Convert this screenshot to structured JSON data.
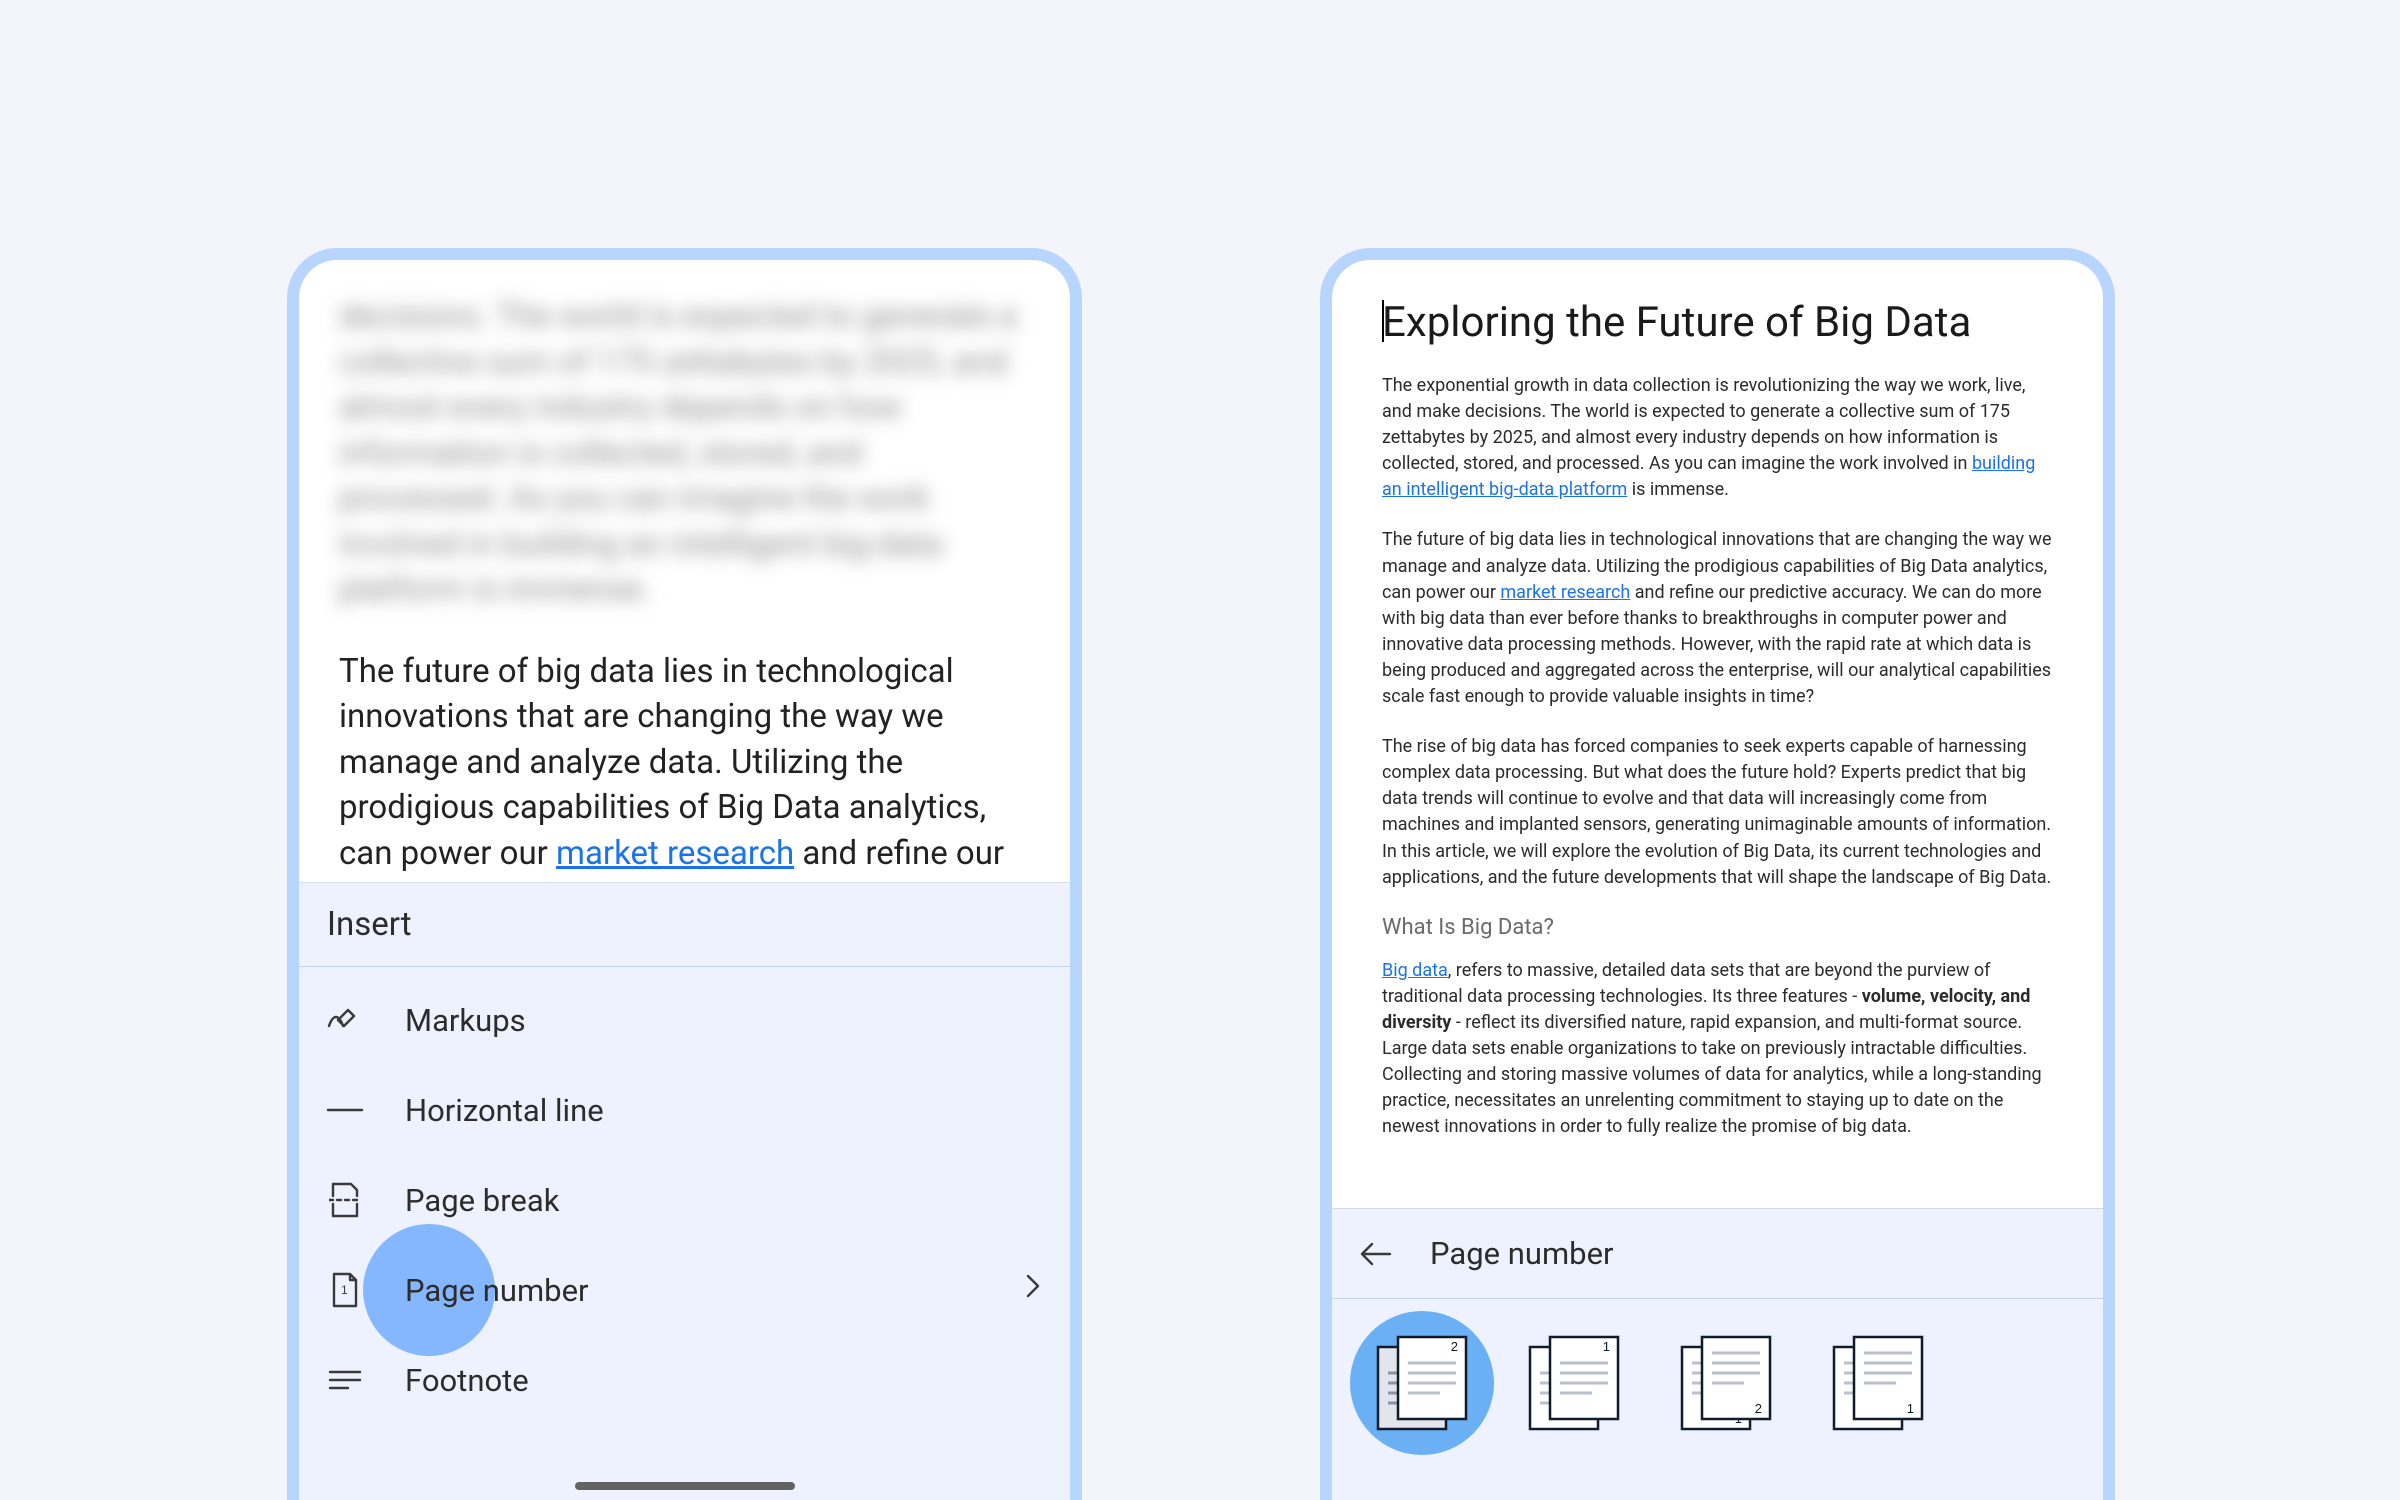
{
  "left": {
    "blurred_text": "decisions. The world is expected to generate a collective sum of 175 zettabytes by 2025, and almost every industry depends on how information is collected, stored, and processed. As you can imagine the work involved in building an intelligent big-data platform is immense.",
    "clear_para_pre": "The future of big data lies in technological innovations that are changing the way we manage and analyze data. Utilizing the prodigious capabilities of Big Data analytics, can power our ",
    "clear_para_link": "market research",
    "clear_para_post": " and refine our predictive accuracy. We can do more with big data than ever before thanks to breakthroughs in",
    "insert_header": "Insert",
    "menu": {
      "markups": "Markups",
      "hr": "Horizontal line",
      "pagebreak": "Page break",
      "pagenumber": "Page number",
      "footnote": "Footnote"
    }
  },
  "right": {
    "title": "Exploring the Future of Big Data",
    "p1_pre": "The exponential growth in data collection is revolutionizing the way we work, live, and make decisions. The world is expected to generate a collective sum of 175 zettabytes by 2025, and almost every industry depends on how information is collected, stored, and processed. As you can imagine the work involved in ",
    "p1_link": "building an intelligent big-data platform",
    "p1_post": " is immense.",
    "p2_pre": "The future of big data lies in technological innovations that are changing the way we manage and analyze data. Utilizing the prodigious capabilities of Big Data analytics, can power our ",
    "p2_link": "market research",
    "p2_post": " and refine our predictive accuracy. We can do more with big data than ever before thanks to breakthroughs in computer power and innovative data processing methods. However, with the rapid rate at which data is being produced and aggregated across the enterprise, will our analytical capabilities scale fast enough to provide valuable insights in time?",
    "p3": "The rise of big data has forced companies to seek experts capable of harnessing complex data processing. But what does the future hold? Experts predict that big data trends will continue to evolve and that data will increasingly come from machines and implanted sensors, generating unimaginable amounts of information. In this article, we will explore the evolution of Big Data, its current technologies and applications, and the future developments that will shape the landscape of Big Data.",
    "subhead": "What Is Big Data?",
    "p4_link": "Big data",
    "p4_pre": ", refers to massive, detailed data sets that are beyond the purview of traditional data processing technologies. Its three features - ",
    "p4_bold": "volume, velocity, and diversity",
    "p4_post": " - reflect its diversified nature, rapid expansion, and multi-format source. Large data sets enable organizations to take on previously intractable difficulties. Collecting and storing massive volumes of data for analytics, while a long-standing practice, necessitates an unrelenting commitment to staying up to date on the newest innovations in order to fully realize the promise of big data.",
    "panel_title": "Page number"
  }
}
